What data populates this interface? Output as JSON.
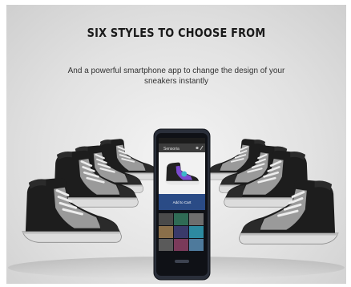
{
  "banner": {
    "headline": "SIX STYLES TO CHOOSE FROM",
    "subline": "And a powerful smartphone app to change the design of your sneakers instantly"
  },
  "phone": {
    "app_title": "Sensoria",
    "buy_label": "Add to Cart"
  },
  "colors": {
    "sneaker_body": "#1d1d1d",
    "sneaker_panel": "#9a9a9a",
    "sole": "#dcdcdc",
    "phone_frame": "#2a2f3a",
    "app_bar": "#3c3c3c",
    "buy_button": "#2a4b86"
  }
}
